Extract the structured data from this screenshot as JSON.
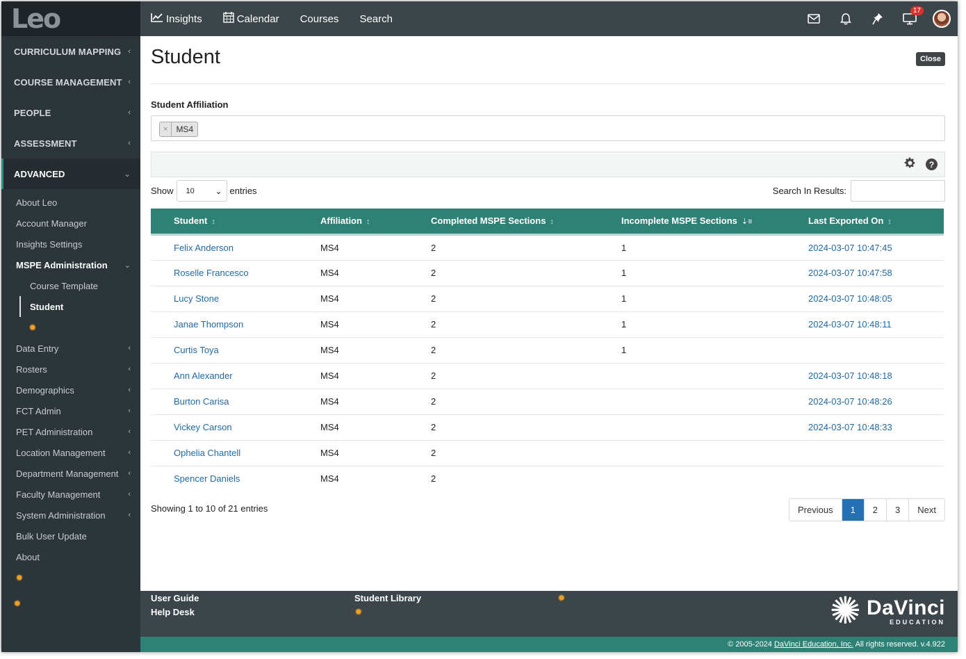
{
  "app": {
    "logo": "Leo"
  },
  "topbar": {
    "nav": [
      {
        "label": "Insights",
        "icon": "chart-line-icon"
      },
      {
        "label": "Calendar",
        "icon": "calendar-icon"
      },
      {
        "label": "Courses"
      },
      {
        "label": "Search"
      }
    ],
    "notification_count": "17"
  },
  "sidebar": {
    "sections": [
      {
        "label": "CURRICULUM MAPPING"
      },
      {
        "label": "COURSE MANAGEMENT"
      },
      {
        "label": "PEOPLE"
      },
      {
        "label": "ASSESSMENT"
      },
      {
        "label": "ADVANCED"
      }
    ],
    "advanced_items_top": [
      {
        "label": "About Leo"
      },
      {
        "label": "Account Manager"
      },
      {
        "label": "Insights Settings"
      },
      {
        "label": "MSPE Administration"
      }
    ],
    "mspe_children": [
      {
        "label": "Course Template"
      },
      {
        "label": "Student"
      }
    ],
    "advanced_items_bottom": [
      {
        "label": "Data Entry"
      },
      {
        "label": "Rosters"
      },
      {
        "label": "Demographics"
      },
      {
        "label": "FCT Admin"
      },
      {
        "label": "PET Administration"
      },
      {
        "label": "Location Management"
      },
      {
        "label": "Department Management"
      },
      {
        "label": "Faculty Management"
      },
      {
        "label": "System Administration"
      },
      {
        "label": "Bulk User Update"
      },
      {
        "label": "About"
      }
    ]
  },
  "page": {
    "title": "Student",
    "close_label": "Close",
    "affiliation_label": "Student Affiliation",
    "affiliation_tag": "MS4",
    "show_label": "Show",
    "entries_label": "entries",
    "page_size": "10",
    "search_label": "Search In Results:"
  },
  "table": {
    "columns": [
      "Student",
      "Affiliation",
      "Completed MSPE Sections",
      "Incomplete MSPE Sections",
      "Last Exported On"
    ],
    "rows": [
      {
        "student": "Felix Anderson",
        "affiliation": "MS4",
        "completed": "2",
        "incomplete": "1",
        "exported": "2024-03-07 10:47:45"
      },
      {
        "student": "Roselle Francesco",
        "affiliation": "MS4",
        "completed": "2",
        "incomplete": "1",
        "exported": "2024-03-07 10:47:58"
      },
      {
        "student": "Lucy Stone",
        "affiliation": "MS4",
        "completed": "2",
        "incomplete": "1",
        "exported": "2024-03-07 10:48:05"
      },
      {
        "student": "Janae Thompson",
        "affiliation": "MS4",
        "completed": "2",
        "incomplete": "1",
        "exported": "2024-03-07 10:48:11"
      },
      {
        "student": "Curtis Toya",
        "affiliation": "MS4",
        "completed": "2",
        "incomplete": "1",
        "exported": ""
      },
      {
        "student": "Ann Alexander",
        "affiliation": "MS4",
        "completed": "2",
        "incomplete": "",
        "exported": "2024-03-07 10:48:18"
      },
      {
        "student": "Burton Carisa",
        "affiliation": "MS4",
        "completed": "2",
        "incomplete": "",
        "exported": "2024-03-07 10:48:26"
      },
      {
        "student": "Vickey Carson",
        "affiliation": "MS4",
        "completed": "2",
        "incomplete": "",
        "exported": "2024-03-07 10:48:33"
      },
      {
        "student": "Ophelia Chantell",
        "affiliation": "MS4",
        "completed": "2",
        "incomplete": "",
        "exported": ""
      },
      {
        "student": "Spencer Daniels",
        "affiliation": "MS4",
        "completed": "2",
        "incomplete": "",
        "exported": ""
      }
    ]
  },
  "pagination": {
    "summary": "Showing 1 to 10 of 21 entries",
    "previous": "Previous",
    "pages": [
      "1",
      "2",
      "3"
    ],
    "next": "Next"
  },
  "footer": {
    "user_guide": "User Guide",
    "help_desk": "Help Desk",
    "student_library": "Student Library",
    "brand_name": "DaVinci",
    "brand_sub": "EDUCATION",
    "copyright_prefix": "© 2005-2024",
    "copyright_link": "DaVinci Education, Inc.",
    "copyright_suffix": "All rights reserved. v.4.922"
  },
  "colors": {
    "accent": "#2e8275",
    "link": "#1f6aa5",
    "sidebar": "#2c3539",
    "topbar": "#3c4549",
    "gear": "#f0a021",
    "badge": "#d9322e"
  }
}
